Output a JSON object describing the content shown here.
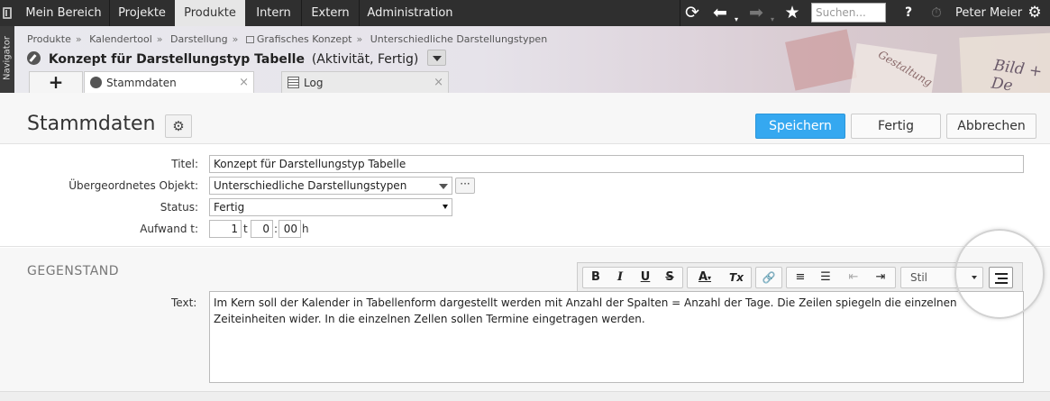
{
  "topnav": {
    "items": [
      "Mein Bereich",
      "Projekte",
      "Produkte",
      "Intern",
      "Extern",
      "Administration"
    ],
    "active": "Produkte",
    "search_placeholder": "Suchen...",
    "user": "Peter Meier",
    "icons": [
      "app-logo-icon",
      "refresh-icon",
      "back-arrow-icon",
      "forward-arrow-icon",
      "star-icon",
      "help-icon",
      "stopwatch-icon",
      "gear-icon"
    ]
  },
  "navigator_label": "Navigator",
  "breadcrumb": [
    "Produkte",
    "Kalendertool",
    "Darstellung",
    "Grafisches Konzept",
    "Unterschiedliche Darstellungstypen"
  ],
  "header": {
    "title": "Konzept für Darstellungstyp Tabelle",
    "meta": "(Aktivität, Fertig)",
    "decor_text": "Bild + De",
    "decor_text2": "Gestaltung"
  },
  "tabs": [
    {
      "label": "Stammdaten",
      "active": true,
      "close": "×"
    },
    {
      "label": "Log",
      "active": false,
      "close": "×"
    }
  ],
  "tab_add_label": "+",
  "page": {
    "title": "Stammdaten",
    "buttons": {
      "save": "Speichern",
      "done": "Fertig",
      "cancel": "Abbrechen"
    }
  },
  "form": {
    "titel_label": "Titel:",
    "titel_value": "Konzept für Darstellungstyp Tabelle",
    "parent_label": "Übergeordnetes Objekt:",
    "parent_value": "Unterschiedliche Darstellungstypen",
    "parent_more": "···",
    "status_label": "Status:",
    "status_value": "Fertig",
    "aufwand_label": "Aufwand t:",
    "aufwand_days": "1",
    "aufwand_days_unit": "t",
    "aufwand_hours": "0",
    "aufwand_sep": ":",
    "aufwand_minutes": "00",
    "aufwand_minutes_unit": "h"
  },
  "section": {
    "title": "GEGENSTAND",
    "text_label": "Text:",
    "text": "Im Kern soll der Kalender in Tabellenform dargestellt werden mit Anzahl der Spalten = Anzahl der Tage. Die Zeilen spiegeln die einzelnen Zeiteinheiten wider. In die einzelnen Zellen sollen Termine eingetragen werden.",
    "toolbar": {
      "bold": "B",
      "italic": "I",
      "underline": "U",
      "strike": "S",
      "text_color": "A",
      "remove_format": "Tx",
      "link": "🔗",
      "ordered_list": "≡",
      "bullet_list": "☰",
      "outdent": "⇤",
      "indent": "⇥",
      "style_label": "Stil"
    }
  },
  "colors": {
    "primary": "#35a8f0",
    "topbar": "#2f2f2f"
  }
}
